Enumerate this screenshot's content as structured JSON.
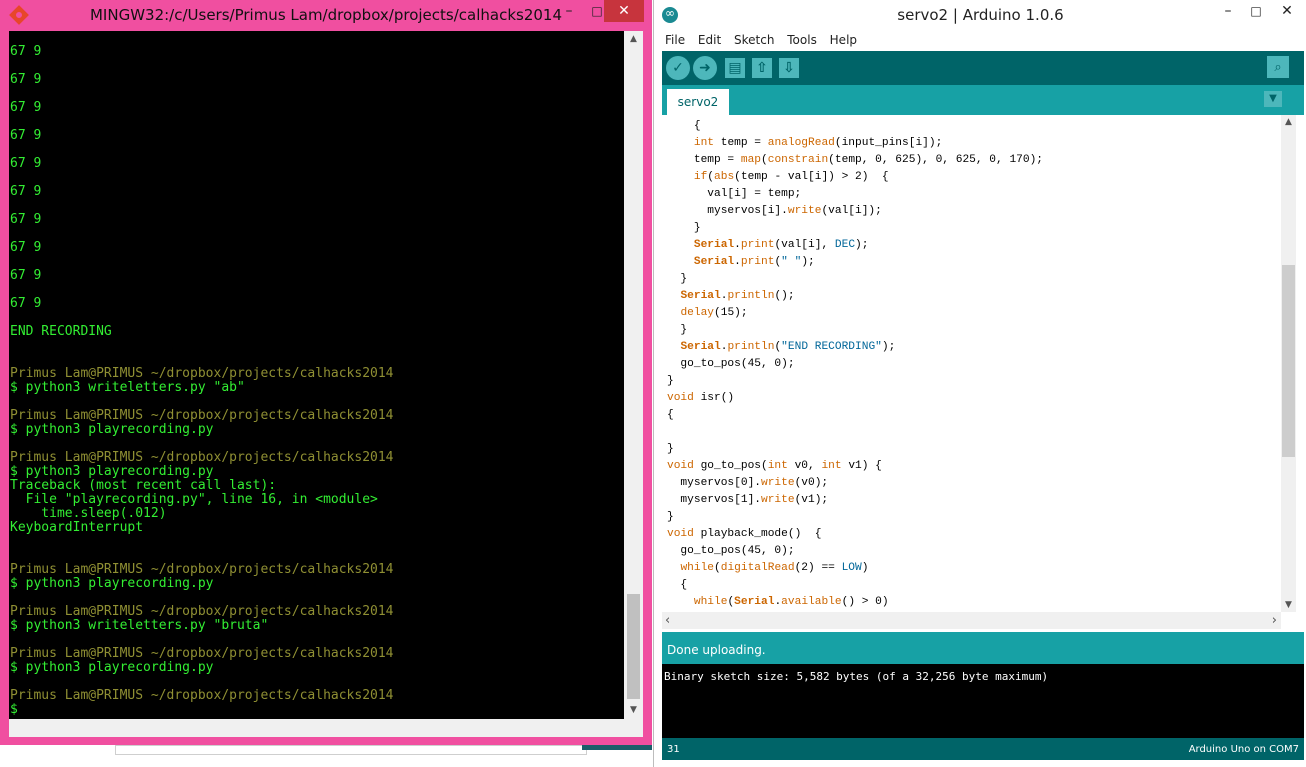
{
  "terminal": {
    "title": "MINGW32:/c/Users/Primus Lam/dropbox/projects/calhacks2014",
    "window_buttons": {
      "minimize": "–",
      "maximize": "□",
      "close": "✕"
    },
    "lines": [
      {
        "text": "67 9",
        "color": "green"
      },
      {
        "text": "67 9",
        "color": "green"
      },
      {
        "text": "67 9",
        "color": "green"
      },
      {
        "text": "67 9",
        "color": "green"
      },
      {
        "text": "67 9",
        "color": "green"
      },
      {
        "text": "67 9",
        "color": "green"
      },
      {
        "text": "67 9",
        "color": "green"
      },
      {
        "text": "67 9",
        "color": "green"
      },
      {
        "text": "67 9",
        "color": "green"
      },
      {
        "text": "67 9",
        "color": "green"
      },
      {
        "text": "END RECORDING",
        "color": "green"
      },
      {
        "text": "Primus Lam@PRIMUS ~/dropbox/projects/calhacks2014",
        "color": "olive"
      },
      {
        "text": "$ python3 writeletters.py \"ab\"",
        "color": "green"
      },
      {
        "text": "Primus Lam@PRIMUS ~/dropbox/projects/calhacks2014",
        "color": "olive"
      },
      {
        "text": "$ python3 playrecording.py",
        "color": "green"
      },
      {
        "text": "Primus Lam@PRIMUS ~/dropbox/projects/calhacks2014",
        "color": "olive"
      },
      {
        "text": "$ python3 playrecording.py",
        "color": "green"
      },
      {
        "text": "Traceback (most recent call last):",
        "color": "green"
      },
      {
        "text": "  File \"playrecording.py\", line 16, in <module>",
        "color": "green"
      },
      {
        "text": "    time.sleep(.012)",
        "color": "green"
      },
      {
        "text": "KeyboardInterrupt",
        "color": "green"
      },
      {
        "text": "Primus Lam@PRIMUS ~/dropbox/projects/calhacks2014",
        "color": "olive"
      },
      {
        "text": "$ python3 playrecording.py",
        "color": "green"
      },
      {
        "text": "Primus Lam@PRIMUS ~/dropbox/projects/calhacks2014",
        "color": "olive"
      },
      {
        "text": "$ python3 writeletters.py \"bruta\"",
        "color": "green"
      },
      {
        "text": "Primus Lam@PRIMUS ~/dropbox/projects/calhacks2014",
        "color": "olive"
      },
      {
        "text": "$ python3 playrecording.py",
        "color": "green"
      },
      {
        "text": "Primus Lam@PRIMUS ~/dropbox/projects/calhacks2014",
        "color": "olive"
      },
      {
        "text": "$",
        "color": "green"
      }
    ]
  },
  "arduino": {
    "title": "servo2 | Arduino 1.0.6",
    "window_buttons": {
      "minimize": "–",
      "maximize": "□",
      "close": "✕"
    },
    "menu": [
      "File",
      "Edit",
      "Sketch",
      "Tools",
      "Help"
    ],
    "toolbar_icons": [
      "verify-icon",
      "upload-icon",
      "new-icon",
      "open-icon",
      "save-icon",
      "serial-monitor-icon"
    ],
    "tab": "servo2",
    "code_lines": [
      "    {",
      "    int temp = analogRead(input_pins[i]);",
      "    temp = map(constrain(temp, 0, 625), 0, 625, 0, 170);",
      "    if(abs(temp - val[i]) > 2)  {",
      "      val[i] = temp;",
      "      myservos[i].write(val[i]);",
      "    }",
      "    Serial.print(val[i], DEC);",
      "    Serial.print(\" \");",
      "  }",
      "  Serial.println();",
      "  delay(15);",
      "  }",
      "  Serial.println(\"END RECORDING\");",
      "  go_to_pos(45, 0);",
      "}",
      "void isr()",
      "{",
      "",
      "}",
      "void go_to_pos(int v0, int v1) {",
      "  myservos[0].write(v0);",
      "  myservos[1].write(v1);",
      "}",
      "void playback_mode()  {",
      "  go_to_pos(45, 0);",
      "  while(digitalRead(2) == LOW)",
      "  {",
      "    while(Serial.available() > 0)"
    ],
    "status": "Done uploading.",
    "console": "Binary sketch size: 5,582 bytes (of a 32,256 byte maximum)",
    "footer_line": "31",
    "footer_board": "Arduino Uno on COM7",
    "colors": {
      "teal_dark": "#006468",
      "teal": "#17a1a5",
      "keyword": "#cc6600",
      "constant": "#006699"
    }
  }
}
